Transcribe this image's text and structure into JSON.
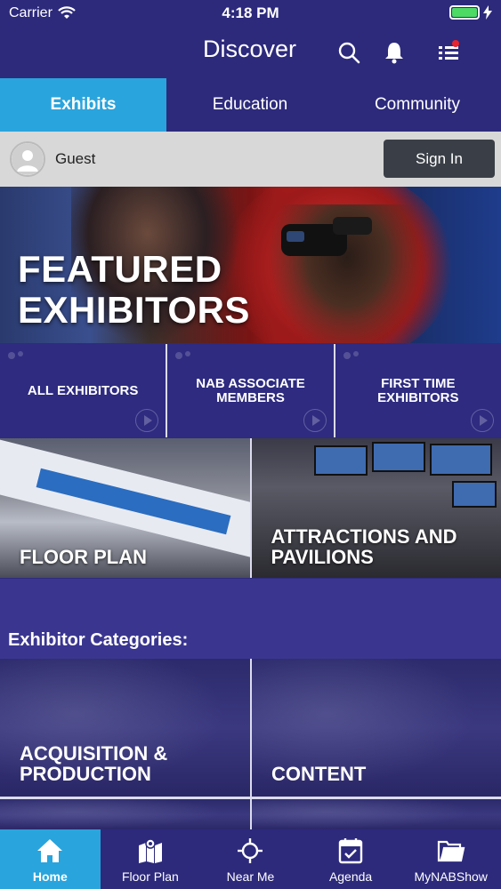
{
  "status_bar": {
    "carrier": "Carrier",
    "time": "4:18 PM",
    "battery_level": 1.0
  },
  "nav": {
    "title": "Discover"
  },
  "tabs": [
    {
      "label": "Exhibits",
      "active": true
    },
    {
      "label": "Education",
      "active": false
    },
    {
      "label": "Community",
      "active": false
    }
  ],
  "user": {
    "name": "Guest",
    "sign_in_label": "Sign In"
  },
  "hero": {
    "title_line1": "FEATURED",
    "title_line2": "EXHIBITORS"
  },
  "quick_links": [
    {
      "line1": "ALL EXHIBITORS",
      "line2": ""
    },
    {
      "line1": "NAB ASSOCIATE",
      "line2": "MEMBERS"
    },
    {
      "line1": "FIRST TIME",
      "line2": "EXHIBITORS"
    }
  ],
  "photo_tiles": [
    {
      "line1": "FLOOR PLAN",
      "line2": ""
    },
    {
      "line1": "ATTRACTIONS AND",
      "line2": "PAVILIONS"
    }
  ],
  "categories": {
    "heading": "Exhibitor Categories:",
    "items": [
      {
        "line1": "ACQUISITION &",
        "line2": "PRODUCTION"
      },
      {
        "line1": "CONTENT",
        "line2": ""
      }
    ]
  },
  "tab_bar": [
    {
      "label": "Home",
      "icon": "home-icon",
      "active": true
    },
    {
      "label": "Floor Plan",
      "icon": "map-icon",
      "active": false
    },
    {
      "label": "Near Me",
      "icon": "crosshair-icon",
      "active": false
    },
    {
      "label": "Agenda",
      "icon": "calendar-icon",
      "active": false
    },
    {
      "label": "MyNABShow",
      "icon": "folder-icon",
      "active": false
    }
  ],
  "colors": {
    "primary": "#2d2a7c",
    "accent": "#2aa4dc",
    "notification": "#e8242f"
  }
}
